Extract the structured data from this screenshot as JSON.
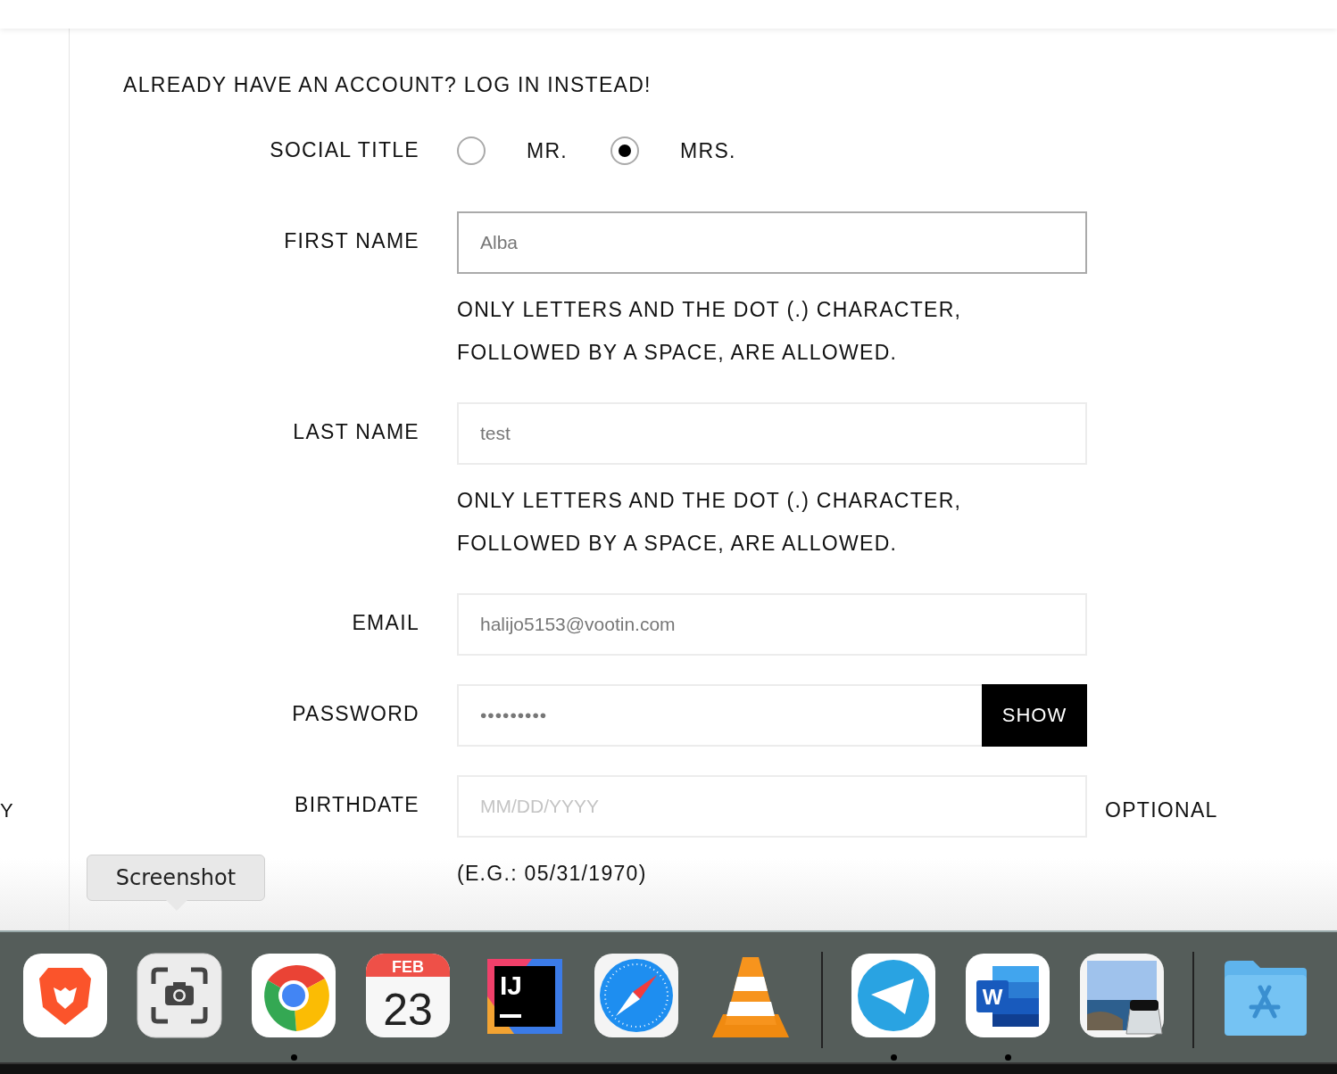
{
  "edge_text": "Y",
  "form": {
    "login_prompt": "ALREADY HAVE AN ACCOUNT? LOG IN INSTEAD!",
    "rows": [
      {
        "kind": "radio",
        "label": "SOCIAL TITLE",
        "options": [
          {
            "label": "MR.",
            "selected": false
          },
          {
            "label": "MRS.",
            "selected": true
          }
        ]
      },
      {
        "kind": "text",
        "label": "FIRST NAME",
        "value": "Alba",
        "focused": true,
        "hint": "ONLY LETTERS AND THE DOT (.) CHARACTER, FOLLOWED BY A SPACE, ARE ALLOWED."
      },
      {
        "kind": "text",
        "label": "LAST NAME",
        "value": "test",
        "focused": false,
        "hint": "ONLY LETTERS AND THE DOT (.) CHARACTER, FOLLOWED BY A SPACE, ARE ALLOWED."
      },
      {
        "kind": "text",
        "label": "EMAIL",
        "value": "halijo5153@vootin.com",
        "focused": false
      },
      {
        "kind": "password",
        "label": "PASSWORD",
        "value": "•••••••••",
        "button": "SHOW"
      },
      {
        "kind": "date",
        "label": "BIRTHDATE",
        "placeholder": "MM/DD/YYYY",
        "note": "OPTIONAL",
        "hint": "(E.G.: 05/31/1970)"
      }
    ]
  },
  "tooltip": "Screenshot",
  "dock": [
    {
      "kind": "brave",
      "running": false
    },
    {
      "kind": "screenshot",
      "running": false
    },
    {
      "kind": "chrome",
      "running": true
    },
    {
      "kind": "calendar",
      "month": "FEB",
      "day": "23",
      "running": false
    },
    {
      "kind": "intellij",
      "text": "IJ",
      "running": false
    },
    {
      "kind": "safari",
      "running": false
    },
    {
      "kind": "vlc",
      "running": false
    },
    {
      "kind": "separator"
    },
    {
      "kind": "telegram",
      "running": true
    },
    {
      "kind": "word",
      "text": "W",
      "running": true
    },
    {
      "kind": "preview",
      "running": false
    },
    {
      "kind": "separator"
    },
    {
      "kind": "folder",
      "running": false
    }
  ]
}
